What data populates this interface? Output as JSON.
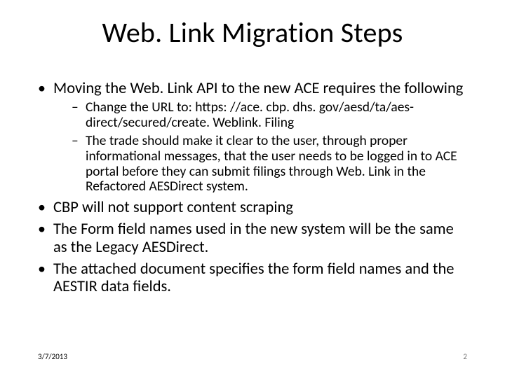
{
  "title": "Web. Link Migration Steps",
  "bullets": [
    {
      "text": "Moving the Web. Link API to the new ACE requires the following",
      "sub": [
        "Change the URL to: https: //ace. cbp. dhs. gov/aesd/ta/aes-direct/secured/create. Weblink. Filing",
        "The trade should make it clear to the user, through proper informational messages, that the user needs to be logged in to ACE portal before they can submit filings through Web. Link in the Refactored AESDirect system."
      ]
    },
    {
      "text": "CBP will not support content scraping"
    },
    {
      "text": "The Form field names used in the new system will be the same as the Legacy AESDirect."
    },
    {
      "text": "The attached document specifies the form field names and the AESTIR data fields."
    }
  ],
  "footer": {
    "date": "3/7/2013",
    "page": "2"
  }
}
